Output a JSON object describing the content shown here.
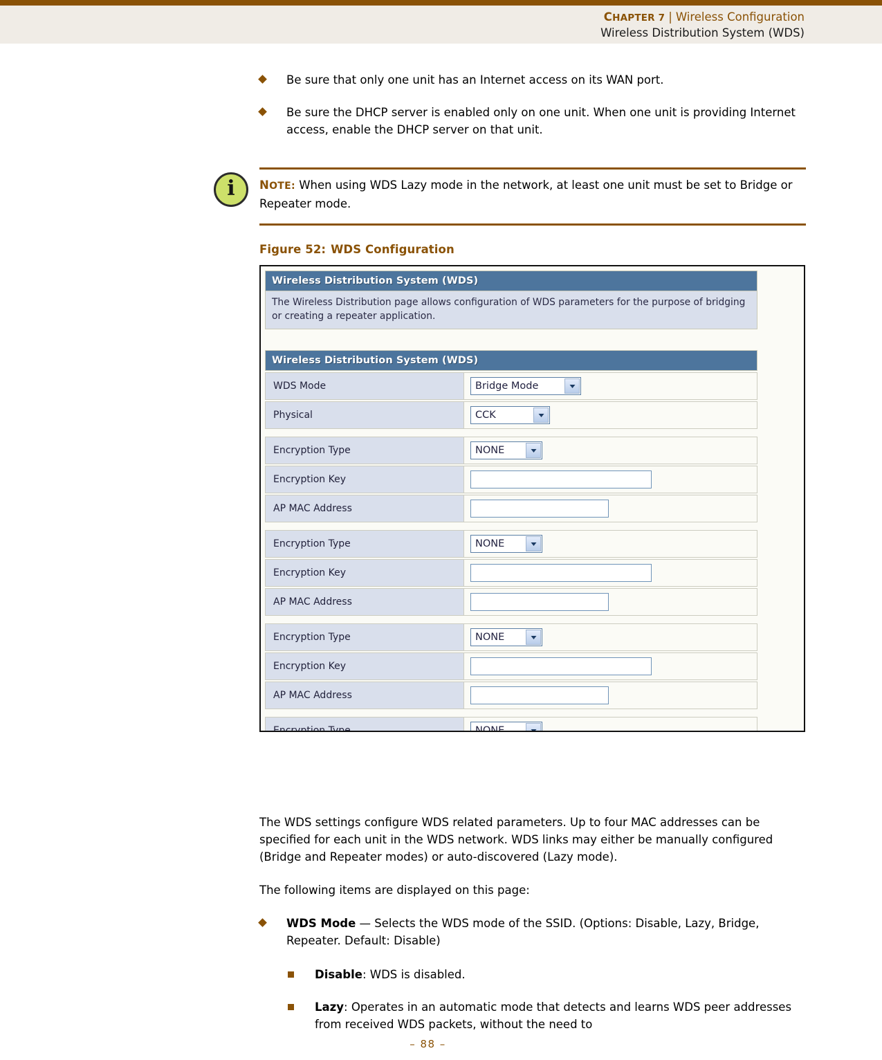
{
  "header": {
    "chapter_label": "Chapter 7",
    "chapter_prefix": "C",
    "chapter_rest": "HAPTER 7",
    "separator": "|",
    "section": "Wireless Configuration",
    "subsection": "Wireless Distribution System (WDS)"
  },
  "top_bullets": [
    "Be sure that only one unit has an Internet access on its WAN port.",
    "Be sure the DHCP server is enabled only on one unit. When one unit is providing Internet access, enable the DHCP server on that unit."
  ],
  "note": {
    "label_cap": "N",
    "label_rest": "OTE:",
    "icon": "info-icon",
    "text": "When using WDS Lazy mode in the network, at least one unit must be set to Bridge or Repeater mode."
  },
  "figure": {
    "caption_number": "Figure 52:",
    "caption_title": "WDS Configuration",
    "ui": {
      "panel_title": "Wireless Distribution System (WDS)",
      "description": "The Wireless Distribution page allows configuration of WDS parameters for the purpose of bridging or creating a repeater application.",
      "form_title": "Wireless Distribution System (WDS)",
      "rows": [
        {
          "label": "WDS Mode",
          "control": "select",
          "value": "Bridge Mode",
          "width": "sel-w-bridge",
          "group_start": false
        },
        {
          "label": "Physical",
          "control": "select",
          "value": "CCK",
          "width": "sel-w-cck",
          "group_start": false
        },
        {
          "label": "Encryption Type",
          "control": "select",
          "value": "NONE",
          "width": "sel-w-none",
          "group_start": true
        },
        {
          "label": "Encryption Key",
          "control": "input",
          "value": "",
          "width": "in-w-key",
          "group_start": false
        },
        {
          "label": "AP MAC Address",
          "control": "input",
          "value": "",
          "width": "in-w-mac",
          "group_start": false
        },
        {
          "label": "Encryption Type",
          "control": "select",
          "value": "NONE",
          "width": "sel-w-none",
          "group_start": true
        },
        {
          "label": "Encryption Key",
          "control": "input",
          "value": "",
          "width": "in-w-key",
          "group_start": false
        },
        {
          "label": "AP MAC Address",
          "control": "input",
          "value": "",
          "width": "in-w-mac",
          "group_start": false
        },
        {
          "label": "Encryption Type",
          "control": "select",
          "value": "NONE",
          "width": "sel-w-none",
          "group_start": true
        },
        {
          "label": "Encryption Key",
          "control": "input",
          "value": "",
          "width": "in-w-key",
          "group_start": false
        },
        {
          "label": "AP MAC Address",
          "control": "input",
          "value": "",
          "width": "in-w-mac",
          "group_start": false
        },
        {
          "label": "Encryption Type",
          "control": "select",
          "value": "NONE",
          "width": "sel-w-none",
          "group_start": true
        }
      ]
    }
  },
  "body": {
    "para1": "The WDS settings configure WDS related parameters. Up to four MAC addresses can be specified for each unit in the WDS network. WDS links may either be manually configured (Bridge and Repeater modes) or auto-discovered (Lazy mode).",
    "para2": "The following items are displayed on this page:",
    "wds_mode_term": "WDS Mode",
    "wds_mode_desc": " — Selects the WDS mode of the SSID. (Options: Disable, Lazy, Bridge, Repeater. Default: Disable)",
    "sub_items": [
      {
        "term": "Disable",
        "desc": ": WDS is disabled."
      },
      {
        "term": "Lazy",
        "desc": ": Operates in an automatic mode that detects and learns WDS peer addresses from received WDS packets, without the need to"
      }
    ]
  },
  "footer": {
    "folio": "–  88  –"
  },
  "colors": {
    "brand_brown": "#8a5206",
    "header_band": "#f0ece6",
    "ui_blue": "#4d759d",
    "ui_label_bg": "#d9dfec",
    "note_icon_green": "#cde06a"
  }
}
